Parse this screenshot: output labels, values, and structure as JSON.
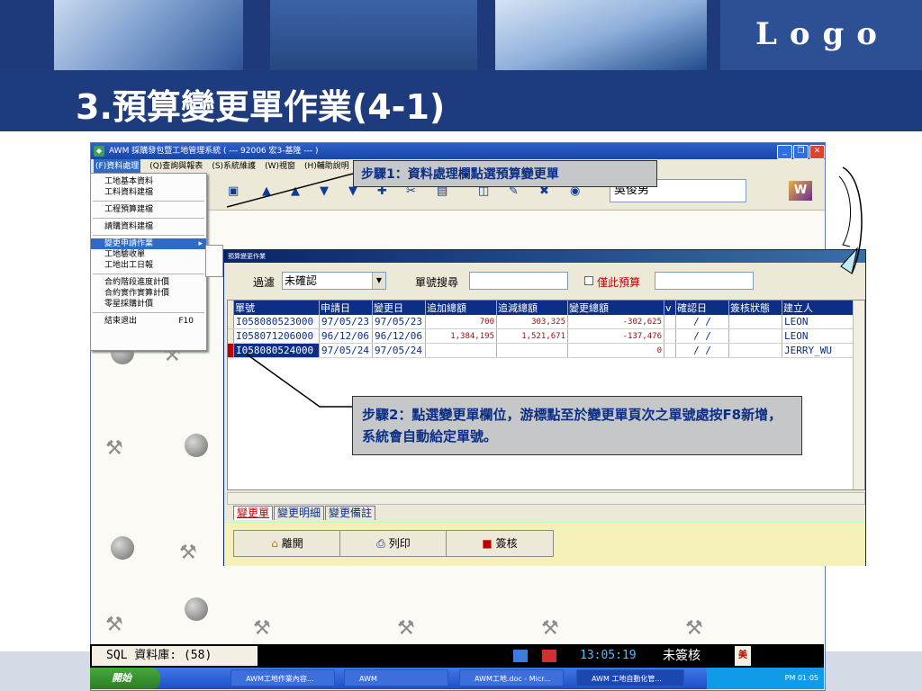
{
  "slide": {
    "logo_text": "Logo",
    "title": "3.預算變更單作業(4-1)"
  },
  "app": {
    "window_title": "AWM 採購發包暨工地管理系統 ( --- 92006 宏3-基隆 --- )",
    "menu": [
      "(F)資料處理",
      "(Q)查詢與報表",
      "(S)系統維護",
      "(W)視窗",
      "(H)輔助說明"
    ],
    "toolbar_field": "吳俊男",
    "toolbar_logo": "W"
  },
  "dropdown": {
    "group1": [
      "工地基本資料",
      "工料資料建檔"
    ],
    "group2": [
      "工程預算建檔"
    ],
    "group3": [
      "請購資料建檔"
    ],
    "group4": [
      "變更申請作業",
      "工地驗收單",
      "工地出工日報"
    ],
    "group5": [
      "合約階段進度計價",
      "合約實作實算計價",
      "零星採購計價"
    ],
    "exit_label": "結束退出",
    "exit_accel": "F10",
    "submenu_arrow": "▸"
  },
  "child": {
    "title": "預算變更作業",
    "filter_label": "過濾",
    "filter_value": "未確認",
    "search_label": "單號搜尋",
    "only_budget_label": "僅此預算",
    "columns": [
      "單號",
      "申請日",
      "變更日",
      "追加總額",
      "追減總額",
      "變更總額",
      "v",
      "確認日",
      "簽核狀態",
      "建立人"
    ],
    "rows": [
      {
        "no": "I058080523000",
        "apply": "97/05/23",
        "change": "97/05/23",
        "add": "700",
        "sub": "303,325",
        "total": "-302,625",
        "v": "",
        "confirm": "/ /",
        "status": "",
        "creator": "LEON"
      },
      {
        "no": "I058071206000",
        "apply": "96/12/06",
        "change": "96/12/06",
        "add": "1,384,195",
        "sub": "1,521,671",
        "total": "-137,476",
        "v": "",
        "confirm": "/ /",
        "status": "",
        "creator": "LEON"
      },
      {
        "no": "I058080524000",
        "apply": "97/05/24",
        "change": "97/05/24",
        "add": "",
        "sub": "",
        "total": "0",
        "v": "",
        "confirm": "/ /",
        "status": "",
        "creator": "JERRY_WU"
      }
    ],
    "tabs": [
      "變更單",
      "變更明細",
      "變更備註"
    ],
    "buttons": {
      "leave": "離開",
      "print": "列印",
      "sign": "簽核"
    }
  },
  "status": {
    "db": "SQL 資料庫: (58)",
    "clock": "13:05:19",
    "sign_state": "未簽核",
    "badge": "美"
  },
  "taskbar": {
    "start": "開始",
    "tasks": [
      "AWM工地作業內容...",
      "AWM",
      "AWM工地.doc - Micr...",
      "AWM 工地自動化管..."
    ],
    "time": "PM 01:05"
  },
  "callouts": {
    "step1": "步驟1：資料處理欄點選預算變更單",
    "step2": "步驟2：點選變更單欄位，游標點至於變更單頁次之單號處按F8新增，系統會自動給定單號。"
  },
  "colors": {
    "banner": "#1e3b7d",
    "grid_header": "#0b2e86",
    "callout_bg": "#c6c7c9"
  }
}
